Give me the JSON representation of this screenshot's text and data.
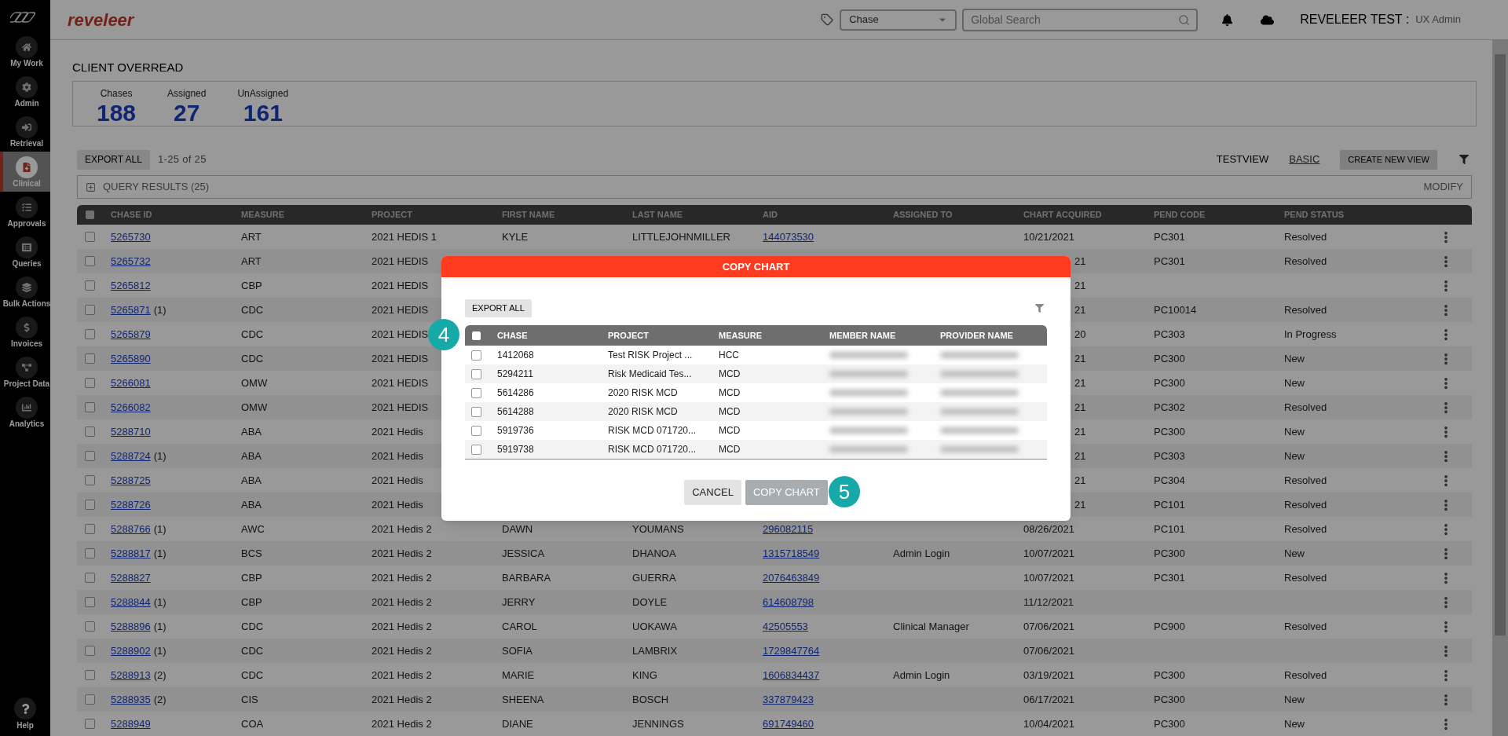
{
  "sidebar": {
    "items": [
      {
        "label": "My Work",
        "selected": false
      },
      {
        "label": "Admin",
        "selected": false
      },
      {
        "label": "Retrieval",
        "selected": false
      },
      {
        "label": "Clinical",
        "selected": true
      },
      {
        "label": "Approvals",
        "selected": false
      },
      {
        "label": "Queries",
        "selected": false
      },
      {
        "label": "Bulk Actions",
        "selected": false
      },
      {
        "label": "Invoices",
        "selected": false
      },
      {
        "label": "Project Data",
        "selected": false
      },
      {
        "label": "Analytics",
        "selected": false
      }
    ],
    "help": "Help"
  },
  "header": {
    "logo": "reveleer",
    "type_select": "Chase",
    "search": {
      "placeholder": "Global Search"
    },
    "user": "REVELEER TEST :",
    "role": "UX Admin"
  },
  "page": {
    "title": "CLIENT OVERREAD",
    "stats": [
      {
        "label": "Chases",
        "value": "188"
      },
      {
        "label": "Assigned",
        "value": "27"
      },
      {
        "label": "UnAssigned",
        "value": "161"
      }
    ],
    "export": "EXPORT ALL",
    "range": "1-25 of 25",
    "views": [
      {
        "label": "TESTVIEW",
        "selected": false
      },
      {
        "label": "BASIC",
        "selected": true
      }
    ],
    "create_view": "CREATE NEW VIEW",
    "query": {
      "title": "QUERY RESULTS (25)",
      "action": "MODIFY"
    }
  },
  "table": {
    "select_all": false,
    "columns": [
      "CHASE ID",
      "MEASURE",
      "PROJECT",
      "FIRST NAME",
      "LAST NAME",
      "AID",
      "ASSIGNED TO",
      "CHART ACQUIRED",
      "PEND CODE",
      "PEND STATUS"
    ],
    "rows": [
      {
        "checked": false,
        "covered": false,
        "chase_id": "5265730",
        "measure": "ART",
        "project": "2021 HEDIS 1",
        "first_name": "KYLE",
        "last_name": "LITTLEJOHNMILLER",
        "aid": "144073530",
        "chart_acquired": "10/21/2021",
        "pend_code": "PC301",
        "pend_status": "Resolved"
      },
      {
        "checked": false,
        "covered": true,
        "chase_id": "5265732",
        "measure": "ART",
        "project": "2021 HEDIS",
        "chart_acquired": "21",
        "pend_code": "PC301",
        "pend_status": "Resolved"
      },
      {
        "checked": false,
        "covered": true,
        "chase_id": "5265812",
        "measure": "CBP",
        "project": "2021 HEDIS",
        "chart_acquired": "21"
      },
      {
        "checked": false,
        "covered": true,
        "chase_id": "5265871",
        "count": "(1)",
        "measure": "CDC",
        "project": "2021 HEDIS",
        "chart_acquired": "21",
        "pend_code": "PC10014",
        "pend_status": "Resolved"
      },
      {
        "checked": false,
        "covered": true,
        "chase_id": "5265879",
        "measure": "CDC",
        "project": "2021 HEDIS",
        "chart_acquired": "20",
        "pend_code": "PC303",
        "pend_status": "In Progress"
      },
      {
        "checked": false,
        "covered": true,
        "chase_id": "5265890",
        "measure": "CDC",
        "project": "2021 HEDIS",
        "chart_acquired": "21",
        "pend_code": "PC300",
        "pend_status": "New"
      },
      {
        "checked": false,
        "covered": true,
        "chase_id": "5266081",
        "measure": "OMW",
        "project": "2021 HEDIS",
        "chart_acquired": "21",
        "pend_code": "PC300",
        "pend_status": "New"
      },
      {
        "checked": false,
        "covered": true,
        "chase_id": "5266082",
        "measure": "OMW",
        "project": "2021 HEDIS",
        "chart_acquired": "21",
        "pend_code": "PC302",
        "pend_status": "Resolved"
      },
      {
        "checked": false,
        "covered": true,
        "chase_id": "5288710",
        "measure": "ABA",
        "project": "2021 Hedis",
        "chart_acquired": "21",
        "pend_code": "PC300",
        "pend_status": "New"
      },
      {
        "checked": false,
        "covered": true,
        "chase_id": "5288724",
        "count": "(1)",
        "measure": "ABA",
        "project": "2021 Hedis",
        "chart_acquired": "21",
        "pend_code": "PC303",
        "pend_status": "New"
      },
      {
        "checked": false,
        "covered": true,
        "chase_id": "5288725",
        "measure": "ABA",
        "project": "2021 Hedis",
        "chart_acquired": "21",
        "pend_code": "PC304",
        "pend_status": "Resolved"
      },
      {
        "checked": false,
        "covered": true,
        "chase_id": "5288726",
        "measure": "ABA",
        "project": "2021 Hedis",
        "chart_acquired": "21",
        "pend_code": "PC101",
        "pend_status": "Resolved"
      },
      {
        "checked": false,
        "covered": false,
        "chase_id": "5288766",
        "count": "(1)",
        "measure": "AWC",
        "project": "2021 Hedis 2",
        "first_name": "DAWN",
        "last_name": "YOUMANS",
        "aid": "296082115",
        "chart_acquired": "08/26/2021",
        "pend_code": "PC101",
        "pend_status": "Resolved"
      },
      {
        "checked": false,
        "covered": false,
        "chase_id": "5288817",
        "count": "(1)",
        "measure": "BCS",
        "project": "2021 Hedis 2",
        "first_name": "JESSICA",
        "last_name": "DHANOA",
        "aid": "1315718549",
        "assigned_to": "Admin Login",
        "chart_acquired": "10/07/2021",
        "pend_code": "PC300",
        "pend_status": "New"
      },
      {
        "checked": false,
        "covered": false,
        "chase_id": "5288827",
        "measure": "CBP",
        "project": "2021 Hedis 2",
        "first_name": "BARBARA",
        "last_name": "GUERRA",
        "aid": "2076463849",
        "chart_acquired": "10/07/2021",
        "pend_code": "PC301",
        "pend_status": "Resolved"
      },
      {
        "checked": false,
        "covered": false,
        "chase_id": "5288844",
        "count": "(1)",
        "measure": "CBP",
        "project": "2021 Hedis 2",
        "first_name": "JERRY",
        "last_name": "DOYLE",
        "aid": "614608798",
        "chart_acquired": "11/12/2021"
      },
      {
        "checked": false,
        "covered": false,
        "chase_id": "5288896",
        "count": "(1)",
        "measure": "CDC",
        "project": "2021 Hedis 2",
        "first_name": "CAROL",
        "last_name": "UOKAWA",
        "aid": "42505553",
        "assigned_to": "Clinical Manager",
        "chart_acquired": "07/06/2021",
        "pend_code": "PC900",
        "pend_status": "Resolved"
      },
      {
        "checked": false,
        "covered": false,
        "chase_id": "5288902",
        "count": "(1)",
        "measure": "CDC",
        "project": "2021 Hedis 2",
        "first_name": "SOFIA",
        "last_name": "LAMBRIX",
        "aid": "1729847764",
        "chart_acquired": "07/06/2021"
      },
      {
        "checked": false,
        "covered": false,
        "chase_id": "5288913",
        "count": "(2)",
        "measure": "CDC",
        "project": "2021 Hedis 2",
        "first_name": "MARIE",
        "last_name": "KING",
        "aid": "1606834437",
        "assigned_to": "Admin Login",
        "chart_acquired": "03/19/2021",
        "pend_code": "PC300",
        "pend_status": "Resolved"
      },
      {
        "checked": false,
        "covered": false,
        "chase_id": "5288935",
        "count": "(2)",
        "measure": "CIS",
        "project": "2021 Hedis 2",
        "first_name": "SHEENA",
        "last_name": "BOSCH",
        "aid": "337879423",
        "chart_acquired": "06/17/2021",
        "pend_code": "PC300",
        "pend_status": "New"
      },
      {
        "checked": false,
        "covered": false,
        "chase_id": "5288949",
        "measure": "COA",
        "project": "2021 Hedis 2",
        "first_name": "DIANE",
        "last_name": "JENNINGS",
        "aid": "691749460",
        "chart_acquired": "10/04/2021",
        "pend_code": "PC300",
        "pend_status": "New"
      }
    ]
  },
  "modal": {
    "title": "COPY CHART",
    "export": "EXPORT ALL",
    "select_all": false,
    "columns": [
      "CHASE",
      "PROJECT",
      "MEASURE",
      "MEMBER NAME",
      "PROVIDER NAME"
    ],
    "rows": [
      {
        "checked": false,
        "chase": "1412068",
        "project": "Test RISK Project ...",
        "measure": "HCC"
      },
      {
        "checked": false,
        "chase": "5294211",
        "project": "Risk Medicaid Tes...",
        "measure": "MCD"
      },
      {
        "checked": false,
        "chase": "5614286",
        "project": "2020 RISK MCD",
        "measure": "MCD"
      },
      {
        "checked": false,
        "chase": "5614288",
        "project": "2020 RISK MCD",
        "measure": "MCD"
      },
      {
        "checked": false,
        "chase": "5919736",
        "project": "RISK MCD 071720...",
        "measure": "MCD"
      },
      {
        "checked": false,
        "chase": "5919738",
        "project": "RISK MCD 071720...",
        "measure": "MCD"
      }
    ],
    "cancel": "CANCEL",
    "confirm": {
      "label": "COPY CHART",
      "disabled": true
    }
  },
  "callouts": [
    "4",
    "5"
  ]
}
